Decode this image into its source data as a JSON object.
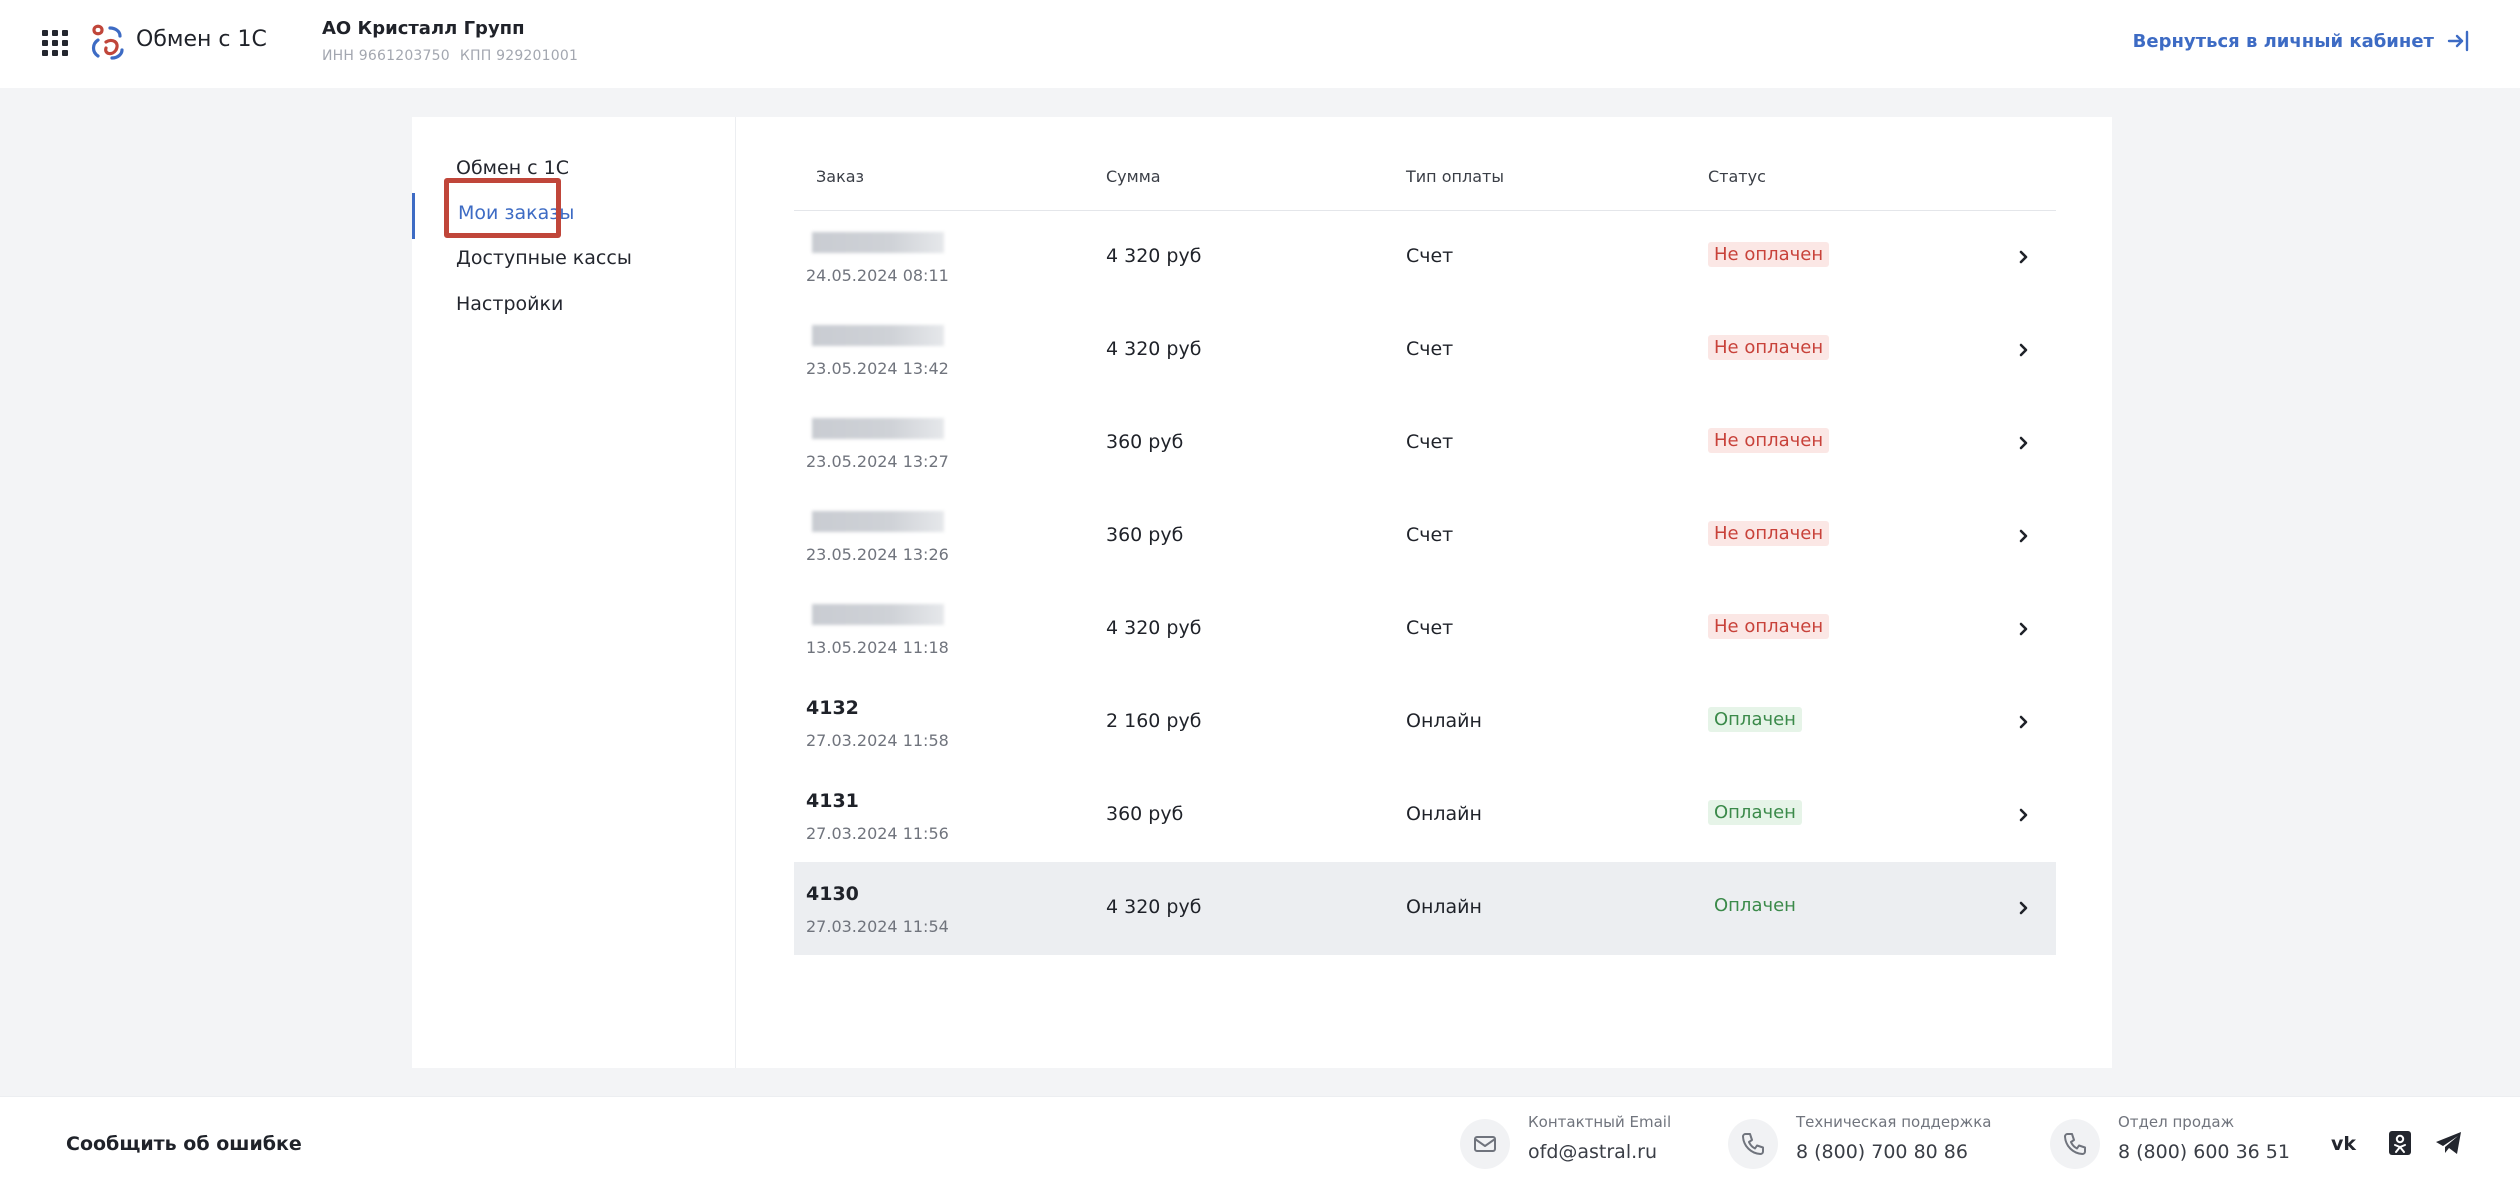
{
  "header": {
    "app_title": "Обмен с 1С",
    "company_name": "АО Кристалл Групп",
    "inn": "ИНН 9661203750",
    "kpp": "КПП 929201001",
    "back_link": "Вернуться в личный кабинет"
  },
  "sidebar": {
    "items": [
      {
        "label": "Обмен с 1С"
      },
      {
        "label": "Мои заказы"
      },
      {
        "label": "Доступные кассы"
      },
      {
        "label": "Настройки"
      }
    ],
    "active_index": 1
  },
  "table": {
    "columns": [
      "Заказ",
      "Сумма",
      "Тип оплаты",
      "Статус"
    ],
    "rows": [
      {
        "order": "",
        "date": "24.05.2024  08:11",
        "sum": "4 320 руб",
        "payment": "Счет",
        "status": "Не оплачен",
        "paid": false
      },
      {
        "order": "",
        "date": "23.05.2024  13:42",
        "sum": "4 320 руб",
        "payment": "Счет",
        "status": "Не оплачен",
        "paid": false
      },
      {
        "order": "",
        "date": "23.05.2024  13:27",
        "sum": "360 руб",
        "payment": "Счет",
        "status": "Не оплачен",
        "paid": false
      },
      {
        "order": "",
        "date": "23.05.2024  13:26",
        "sum": "360 руб",
        "payment": "Счет",
        "status": "Не оплачен",
        "paid": false
      },
      {
        "order": "",
        "date": "13.05.2024  11:18",
        "sum": "4 320 руб",
        "payment": "Счет",
        "status": "Не оплачен",
        "paid": false
      },
      {
        "order": "4132",
        "date": "27.03.2024  11:58",
        "sum": "2 160 руб",
        "payment": "Онлайн",
        "status": "Оплачен",
        "paid": true
      },
      {
        "order": "4131",
        "date": "27.03.2024  11:56",
        "sum": "360 руб",
        "payment": "Онлайн",
        "status": "Оплачен",
        "paid": true
      },
      {
        "order": "4130",
        "date": "27.03.2024  11:54",
        "sum": "4 320 руб",
        "payment": "Онлайн",
        "status": "Оплачен",
        "paid": true
      }
    ],
    "selected_index": 7
  },
  "footer": {
    "report_error": "Сообщить об ошибке",
    "contacts": [
      {
        "label": "Контактный Email",
        "value": "ofd@astral.ru",
        "icon": "mail-icon"
      },
      {
        "label": "Техническая поддержка",
        "value": "8 (800) 700 80 86",
        "icon": "phone-icon"
      },
      {
        "label": "Отдел продаж",
        "value": "8 (800) 600 36 51",
        "icon": "phone-icon"
      }
    ],
    "social": [
      "vk-icon",
      "odnoklassniki-icon",
      "telegram-icon"
    ]
  },
  "colors": {
    "accent": "#3d6bc4",
    "unpaid": "#c8423a",
    "paid": "#3b8a4a",
    "highlight_box": "#c0463a"
  }
}
